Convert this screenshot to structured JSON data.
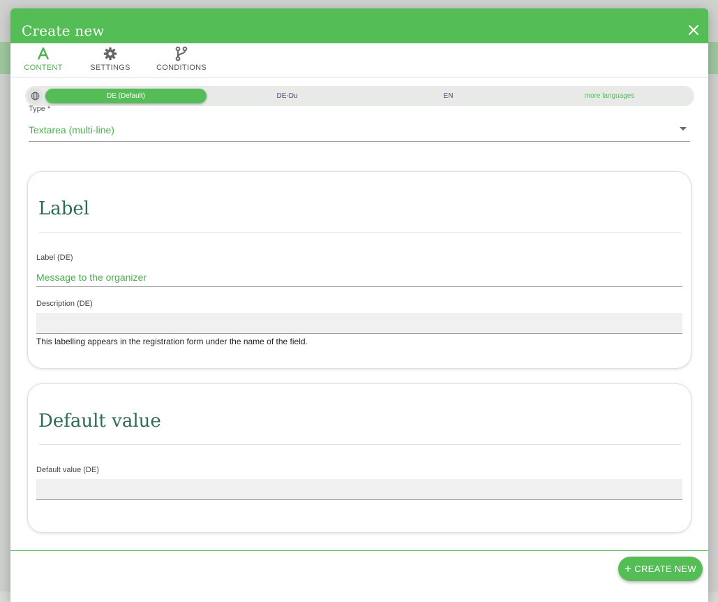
{
  "dialog": {
    "title": "Create new",
    "close_icon": "close-icon"
  },
  "tabs": [
    {
      "label": "CONTENT",
      "icon": "font-icon",
      "active": true
    },
    {
      "label": "SETTINGS",
      "icon": "gear-icon",
      "active": false
    },
    {
      "label": "CONDITIONS",
      "icon": "branch-icon",
      "active": false
    }
  ],
  "languages": {
    "globe_icon": "globe-icon",
    "items": [
      {
        "label": "DE (Default)",
        "active": true
      },
      {
        "label": "DE-Du",
        "active": false
      },
      {
        "label": "EN",
        "active": false
      },
      {
        "label": "more languages",
        "active": false
      }
    ]
  },
  "type_field": {
    "label": "Type *",
    "value": "Textarea (multi-line)"
  },
  "label_card": {
    "title": "Label",
    "label_field": {
      "label": "Label (DE)",
      "value": "Message to the organizer"
    },
    "description_field": {
      "label": "Description (DE)",
      "value": ""
    },
    "hint": "This labelling appears in the registration form under the name of the field."
  },
  "default_card": {
    "title": "Default value",
    "default_field": {
      "label": "Default value (DE)",
      "value": ""
    }
  },
  "footer": {
    "create_label": "CREATE NEW"
  },
  "colors": {
    "accent": "#55bd55",
    "heading": "#2c6b55",
    "lang_text": "#5a3d7a"
  }
}
